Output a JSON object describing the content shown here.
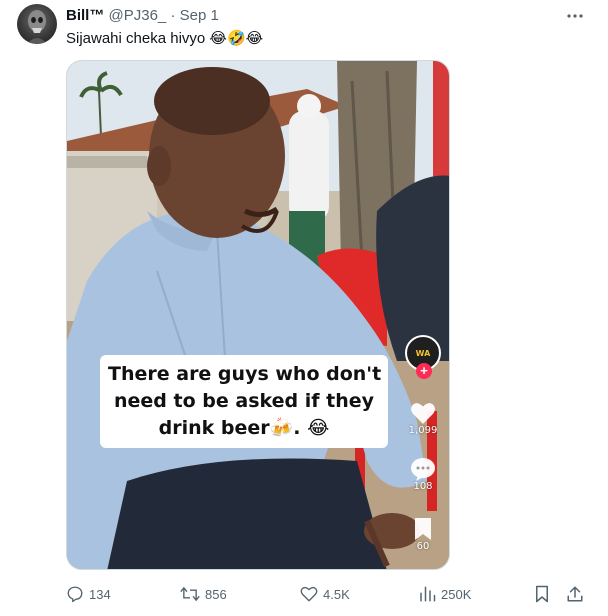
{
  "tweet": {
    "display_name": "Bill™",
    "handle": "@PJ36_",
    "separator": "·",
    "date": "Sep 1",
    "text": "Sijawahi cheka hivyo",
    "emojis": "😂🤣😂"
  },
  "media": {
    "caption_lines": [
      "There are guys who don't",
      "need to be asked if they",
      "drink beer🍻. 😂"
    ],
    "overlay": {
      "account_badge": "WA",
      "likes": "1,099",
      "comments": "108",
      "saves": "60"
    }
  },
  "actions": {
    "replies": "134",
    "reposts": "856",
    "likes": "4.5K",
    "views": "250K"
  },
  "colors": {
    "text_primary": "#0f1419",
    "text_secondary": "#536471",
    "border": "#cfd9de",
    "tiktok_pink": "#fe2c55"
  },
  "icons": {
    "more": "more-dots-icon",
    "reply": "reply-icon",
    "repost": "repost-icon",
    "like": "heart-icon",
    "views": "views-chart-icon",
    "bookmark": "bookmark-icon",
    "share": "share-icon"
  }
}
